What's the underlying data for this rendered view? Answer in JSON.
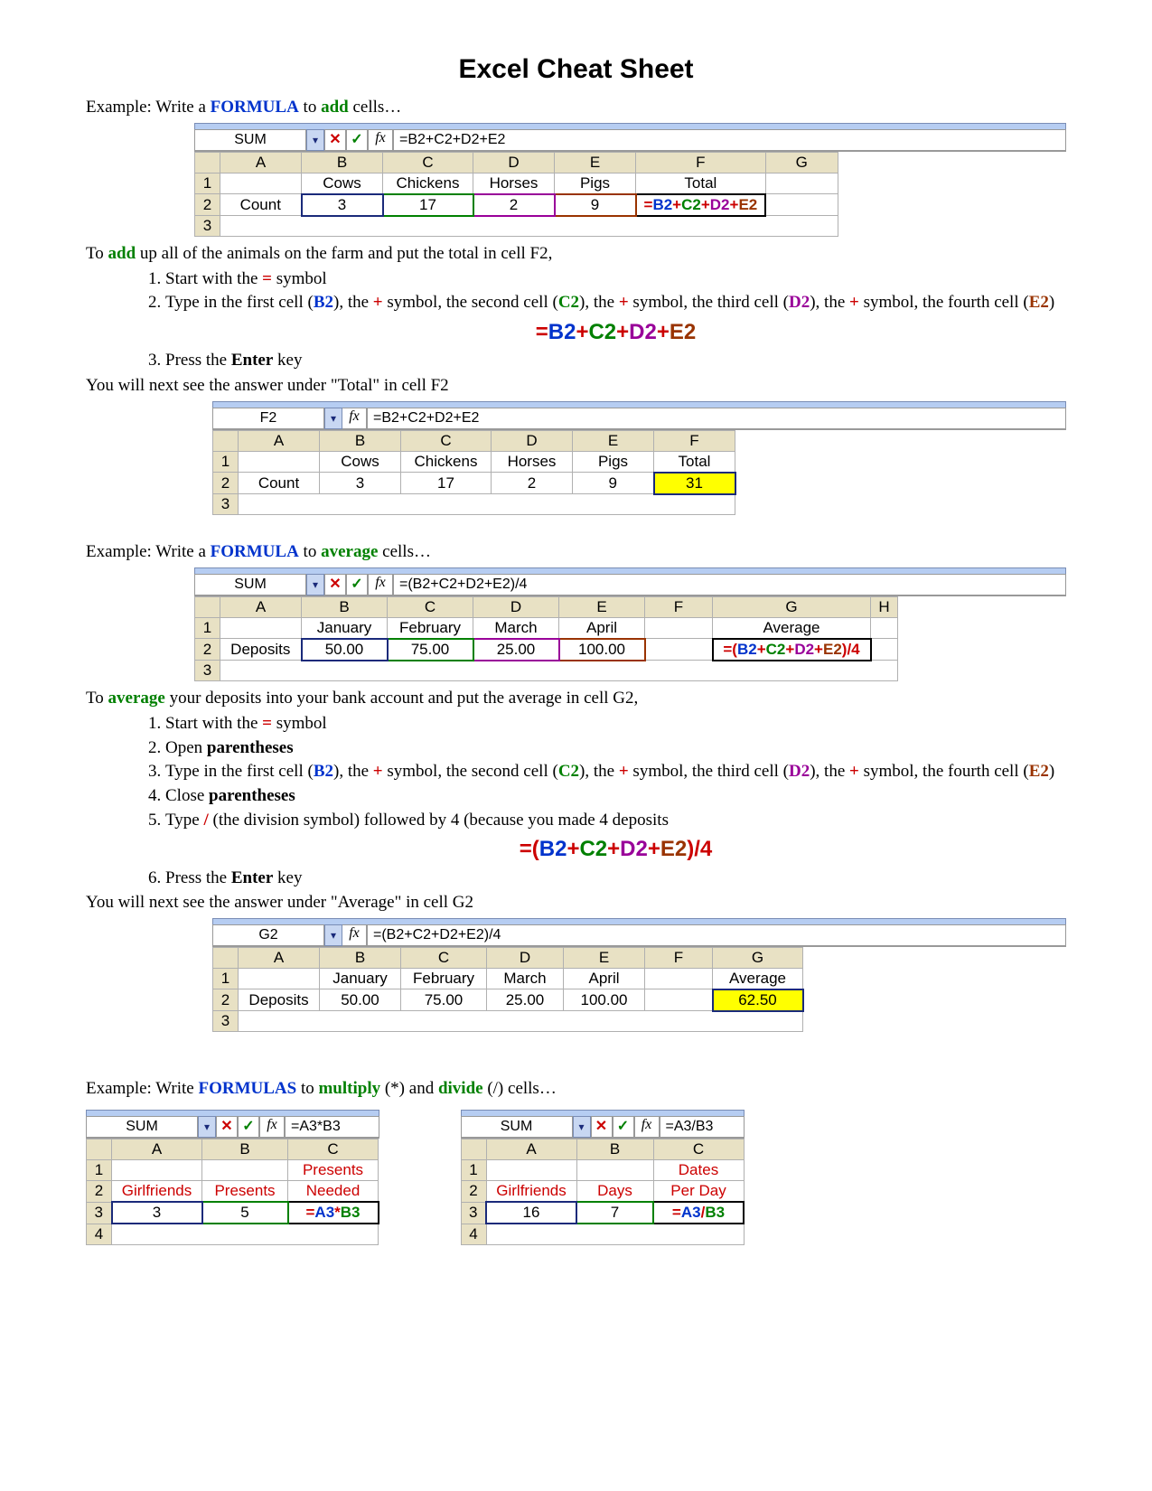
{
  "title": "Excel Cheat Sheet",
  "ex1": {
    "intro_pre": "Example: Write a ",
    "intro_formula": "FORMULA",
    "intro_mid": " to ",
    "intro_add": "add",
    "intro_post": " cells…",
    "fbar_name": "SUM",
    "fbar_formula": "=B2+C2+D2+E2",
    "cols": [
      "A",
      "B",
      "C",
      "D",
      "E",
      "F",
      "G"
    ],
    "row1": [
      "",
      "Cows",
      "Chickens",
      "Horses",
      "Pigs",
      "Total",
      ""
    ],
    "row2": [
      "Count",
      "3",
      "17",
      "2",
      "9",
      "=B2+C2+D2+E2",
      ""
    ],
    "desc_pre": "To ",
    "desc_add": "add",
    "desc_post": " up all of the animals on the farm and put the total in cell F2,",
    "step1_a": "Start with the ",
    "step1_eq": "=",
    "step1_b": " symbol",
    "step2_a": "Type in the first cell (",
    "step2_b2": "B2",
    "step2_b": "), the ",
    "step2_plus": "+",
    "step2_c": " symbol, the second cell (",
    "step2_c2": "C2",
    "step2_d": "), the ",
    "step2_e": " symbol, the third cell (",
    "step2_d2": "D2",
    "step2_f": "), the ",
    "step2_g": " symbol, the fourth cell (",
    "step2_e2": "E2",
    "step2_h": ")",
    "formula_big": {
      "eq": "=",
      "b2": "B2",
      "p1": "+",
      "c2": "C2",
      "p2": "+",
      "d2": "D2",
      "p3": "+",
      "e2": "E2"
    },
    "step3_a": "Press the ",
    "step3_enter": "Enter",
    "step3_b": " key",
    "after": "You will next see the answer under \"Total\" in cell F2",
    "res_fbar_name": "F2",
    "res_fbar_formula": "=B2+C2+D2+E2",
    "res_cols": [
      "A",
      "B",
      "C",
      "D",
      "E",
      "F"
    ],
    "res_row1": [
      "",
      "Cows",
      "Chickens",
      "Horses",
      "Pigs",
      "Total"
    ],
    "res_row2": [
      "Count",
      "3",
      "17",
      "2",
      "9",
      "31"
    ]
  },
  "ex2": {
    "intro_pre": "Example: Write a ",
    "intro_formula": "FORMULA",
    "intro_mid": " to ",
    "intro_avg": "average",
    "intro_post": " cells…",
    "fbar_name": "SUM",
    "fbar_formula": "=(B2+C2+D2+E2)/4",
    "cols": [
      "A",
      "B",
      "C",
      "D",
      "E",
      "F",
      "G",
      "H"
    ],
    "row1": [
      "",
      "January",
      "February",
      "March",
      "April",
      "",
      "Average",
      ""
    ],
    "row2": [
      "Deposits",
      "50.00",
      "75.00",
      "25.00",
      "100.00",
      "",
      "=(B2+C2+D2+E2)/4",
      ""
    ],
    "desc_pre": "To ",
    "desc_avg": "average",
    "desc_post": " your deposits into your bank account and put the average in cell G2,",
    "step1_a": "Start with the ",
    "step1_eq": "=",
    "step1_b": " symbol",
    "step2": "Open ",
    "step2_p": "parentheses",
    "step3_a": "Type in the first cell (",
    "step3_b2": "B2",
    "step3_b": "), the ",
    "step3_plus": "+",
    "step3_c": " symbol, the second cell (",
    "step3_c2": "C2",
    "step3_d": "), the ",
    "step3_e": " symbol, the third cell (",
    "step3_d2": "D2",
    "step3_f": "), the ",
    "step3_g": " symbol, the fourth cell (",
    "step3_e2": "E2",
    "step3_h": ")",
    "step4": "Close ",
    "step4_p": "parentheses",
    "step5_a": "Type ",
    "step5_slash": "/",
    "step5_b": " (the division symbol) followed by 4 (because you made 4 deposits",
    "formula_big": {
      "eq": "=(",
      "b2": "B2",
      "p1": "+",
      "c2": "C2",
      "p2": "+",
      "d2": "D2",
      "p3": "+",
      "e2": "E2",
      "close": ")/4"
    },
    "step6_a": "Press the ",
    "step6_enter": "Enter",
    "step6_b": " key",
    "after": "You will next see the answer under \"Average\" in cell G2",
    "res_fbar_name": "G2",
    "res_fbar_formula": "=(B2+C2+D2+E2)/4",
    "res_cols": [
      "A",
      "B",
      "C",
      "D",
      "E",
      "F",
      "G"
    ],
    "res_row1": [
      "",
      "January",
      "February",
      "March",
      "April",
      "",
      "Average"
    ],
    "res_row2": [
      "Deposits",
      "50.00",
      "75.00",
      "25.00",
      "100.00",
      "",
      "62.50"
    ]
  },
  "ex3": {
    "intro_pre": "Example: Write ",
    "intro_formula": "FORMULAS",
    "intro_mid": " to ",
    "intro_mul": "multiply",
    "intro_mul_sym": " (*) and ",
    "intro_div": "divide",
    "intro_div_sym": " (/) cells…",
    "mult": {
      "fbar_name": "SUM",
      "fbar_formula": "=A3*B3",
      "cols": [
        "A",
        "B",
        "C"
      ],
      "row1": [
        "",
        "",
        "Presents"
      ],
      "row2": [
        "Girlfriends",
        "Presents",
        "Needed"
      ],
      "row3": [
        "3",
        "5",
        "=A3*B3"
      ]
    },
    "div": {
      "fbar_name": "SUM",
      "fbar_formula": "=A3/B3",
      "cols": [
        "A",
        "B",
        "C"
      ],
      "row1": [
        "",
        "",
        "Dates"
      ],
      "row2": [
        "Girlfriends",
        "Days",
        "Per Day"
      ],
      "row3": [
        "16",
        "7",
        "=A3/B3"
      ]
    }
  },
  "glyphs": {
    "drop": "▾",
    "x": "✕",
    "check": "✓",
    "fx": "fx"
  }
}
